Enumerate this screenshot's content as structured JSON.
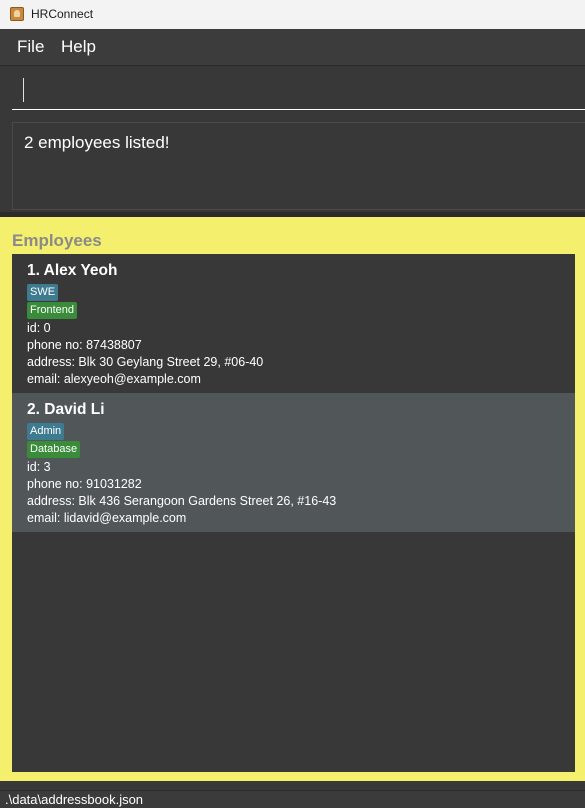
{
  "window": {
    "title": "HRConnect"
  },
  "menu": {
    "file": "File",
    "help": "Help"
  },
  "command": {
    "value": "",
    "placeholder": ""
  },
  "result": {
    "message": "2 employees listed!"
  },
  "list": {
    "title": "Employees",
    "employees": [
      {
        "index": "1.",
        "name": "Alex Yeoh",
        "role": "SWE",
        "department": "Frontend",
        "id": "id: 0",
        "phone": "phone no: 87438807",
        "address": "address: Blk 30 Geylang Street 29, #06-40",
        "email": "email: alexyeoh@example.com"
      },
      {
        "index": "2.",
        "name": "David Li",
        "role": "Admin",
        "department": "Database",
        "id": "id: 3",
        "phone": "phone no: 91031282",
        "address": "address: Blk 436 Serangoon Gardens Street 26, #16-43",
        "email": "email: lidavid@example.com"
      }
    ]
  },
  "status": {
    "path": ".\\data\\addressbook.json"
  },
  "colors": {
    "background": "#383838",
    "list_panel": "#f4f06d",
    "role_tag": "#3e7b91",
    "department_tag": "#3a8b3a",
    "selected_card": "#515658"
  }
}
